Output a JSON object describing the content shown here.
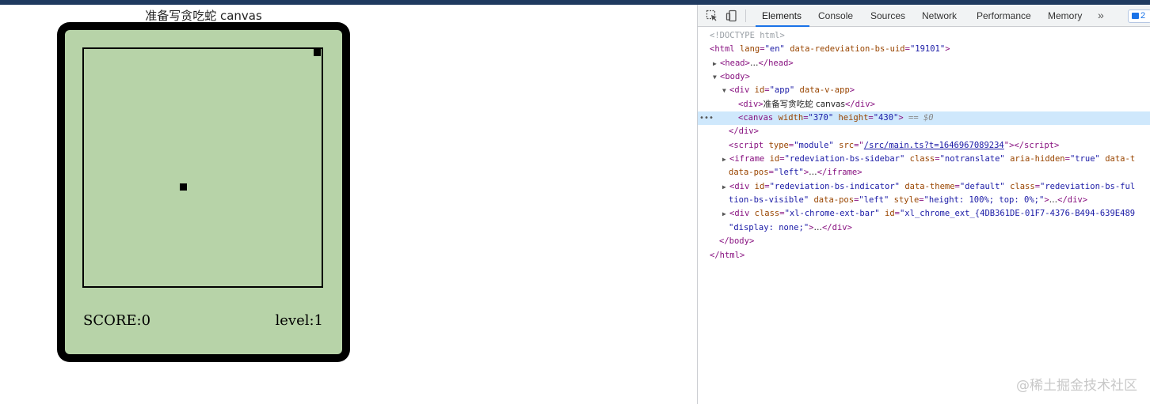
{
  "page": {
    "title": "准备写贪吃蛇 canvas",
    "score_text": "SCORE:0",
    "level_text": "level:1"
  },
  "devtools": {
    "tabs": [
      "Elements",
      "Console",
      "Sources",
      "Network",
      "Performance",
      "Memory"
    ],
    "more": "»",
    "badge_count": "2",
    "dom": {
      "l0": "<!DOCTYPE html>",
      "l1_tag": "html",
      "l1_attr1": "lang",
      "l1_val1": "\"en\"",
      "l1_attr2": "data-redeviation-bs-uid",
      "l1_val2": "\"19101\"",
      "l2": "head",
      "l2_ellipsis": "…",
      "l3": "body",
      "l4_tag": "div",
      "l4_attr1": "id",
      "l4_val1": "\"app\"",
      "l4_attr2": "data-v-app",
      "l5_text": "准备写贪吃蛇 canvas",
      "l6_tag": "canvas",
      "l6_attr1": "width",
      "l6_val1": "\"370\"",
      "l6_attr2": "height",
      "l6_val2": "\"430\"",
      "l6_eq": "== $0",
      "l8_attr1": "type",
      "l8_val1": "\"module\"",
      "l8_attr2": "src",
      "l8_link": "/src/main.ts?t=1646967089234",
      "l9_a": "id",
      "l9_av": "\"redeviation-bs-sidebar\"",
      "l9_b": "class",
      "l9_bv": "\"notranslate\"",
      "l9_c": "aria-hidden",
      "l9_cv": "\"true\"",
      "l9_d": "data-t",
      "l10_a": "data-pos",
      "l10_av": "\"left\"",
      "l11_a": "id",
      "l11_av": "\"redeviation-bs-indicator\"",
      "l11_b": "data-theme",
      "l11_bv": "\"default\"",
      "l11_c": "class",
      "l11_cv": "\"redeviation-bs-ful",
      "l12_cont": "tion-bs-visible\"",
      "l12_a": "data-pos",
      "l12_av": "\"left\"",
      "l12_b": "style",
      "l12_bv": "\"height: 100%; top: 0%;\"",
      "l13_a": "class",
      "l13_av": "\"xl-chrome-ext-bar\"",
      "l13_b": "id",
      "l13_bv": "\"xl_chrome_ext_{4DB361DE-01F7-4376-B494-639E489",
      "l14_cont": "\"display: none;\""
    }
  },
  "watermark": "@稀土掘金技术社区"
}
